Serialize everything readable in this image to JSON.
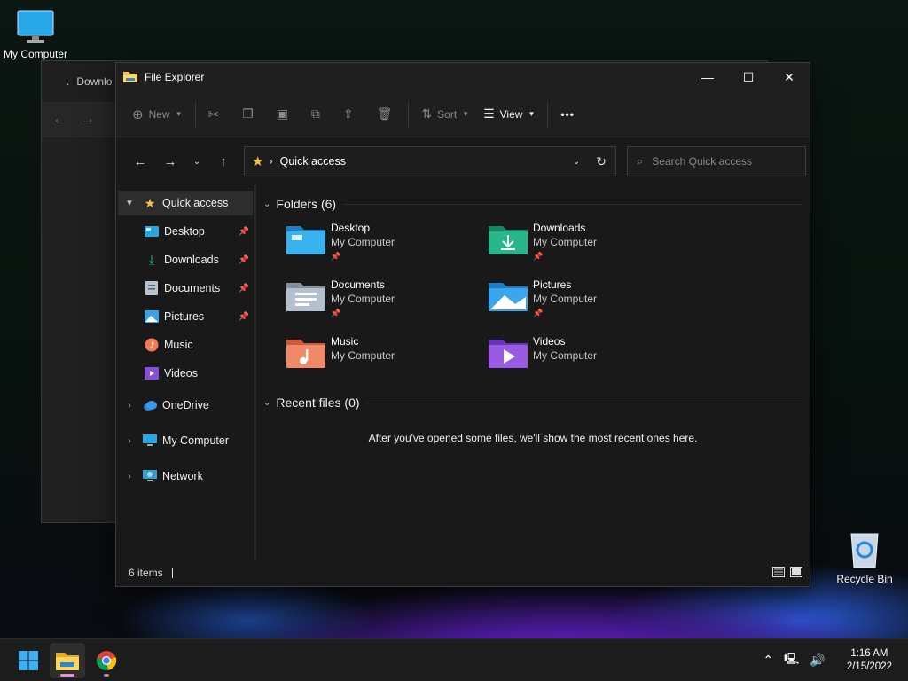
{
  "desktop": {
    "icons": [
      {
        "label": "My Computer"
      },
      {
        "label": "Recycle Bin"
      }
    ]
  },
  "background_window": {
    "title": "Downlo"
  },
  "window": {
    "title": "File Explorer",
    "controls": {
      "minimize": "—",
      "maximize": "☐",
      "close": "✕"
    }
  },
  "toolbar": {
    "new_label": "New",
    "sort_label": "Sort",
    "view_label": "View",
    "more_label": "•••"
  },
  "address": {
    "location": "Quick access",
    "search_placeholder": "Search Quick access"
  },
  "sidebar": {
    "items": [
      {
        "label": "Quick access"
      },
      {
        "label": "Desktop"
      },
      {
        "label": "Downloads"
      },
      {
        "label": "Documents"
      },
      {
        "label": "Pictures"
      },
      {
        "label": "Music"
      },
      {
        "label": "Videos"
      },
      {
        "label": "OneDrive"
      },
      {
        "label": "My Computer"
      },
      {
        "label": "Network"
      }
    ]
  },
  "content": {
    "folders_header": "Folders (6)",
    "folders": [
      {
        "name": "Desktop",
        "location": "My Computer",
        "pinned": true
      },
      {
        "name": "Downloads",
        "location": "My Computer",
        "pinned": true
      },
      {
        "name": "Documents",
        "location": "My Computer",
        "pinned": true
      },
      {
        "name": "Pictures",
        "location": "My Computer",
        "pinned": true
      },
      {
        "name": "Music",
        "location": "My Computer",
        "pinned": false
      },
      {
        "name": "Videos",
        "location": "My Computer",
        "pinned": false
      }
    ],
    "recent_header": "Recent files (0)",
    "recent_empty": "After you've opened some files, we'll show the most recent ones here."
  },
  "status": {
    "items_count": "6 items"
  },
  "taskbar": {
    "time": "1:16 AM",
    "date": "2/15/2022"
  },
  "colors": {
    "accent": "#0078d4",
    "folder_yellow": "#f6c343",
    "window_bg": "#191919"
  }
}
